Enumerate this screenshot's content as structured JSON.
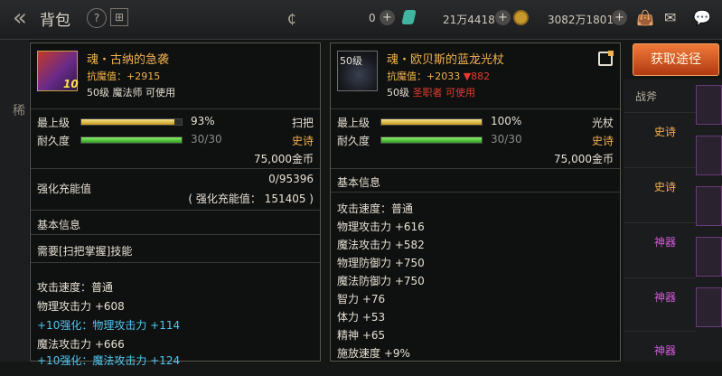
{
  "topbar": {
    "title": "背包",
    "res1": "0",
    "res2": "21万4418",
    "res3": "3082万1801"
  },
  "background": {
    "left_char": "稀",
    "right_header": "战斧",
    "right_rows": [
      "史诗",
      "史诗",
      "神器",
      "神器",
      "神器"
    ],
    "colors": {
      "epic": "#f2b24e",
      "artifact": "#d25ad8"
    }
  },
  "get_button": "获取途径",
  "left_item": {
    "name": "魂・古纳的急袭",
    "magic_resist": "抗魔值：+2915",
    "level_line": "50级 魔法师 可使用",
    "badge": "10",
    "max_level_label": "最上级",
    "max_level_pct": "93%",
    "max_level_fill": 0.93,
    "type": "扫把",
    "durability_label": "耐久度",
    "durability": "30/30",
    "durability_fill": 1,
    "rarity": "史诗",
    "price": "75,000金币",
    "enhance_label": "强化充能值",
    "enhance_value": "0/95396",
    "enhance_sub": "( 强化充能值： 151405 )",
    "basic_title": "基本信息",
    "requirement": "需要[扫把掌握]技能",
    "stats": [
      {
        "text": "攻击速度：普通",
        "cyan": false
      },
      {
        "text": "物理攻击力 +608",
        "cyan": false
      },
      {
        "text": "+10强化：物理攻击力 +114",
        "cyan": true
      },
      {
        "text": "魔法攻击力 +666",
        "cyan": false
      },
      {
        "text": "+10强化：魔法攻击力 +124",
        "cyan": true
      }
    ]
  },
  "right_item": {
    "level_badge": "50级",
    "name": "魂・欧贝斯的蓝龙光杖",
    "magic_resist": "抗魔值：+2033",
    "magic_resist_diff": "▼882",
    "level": "50级",
    "class_req": "圣职者 可使用",
    "max_level_label": "最上级",
    "max_level_pct": "100%",
    "max_level_fill": 1,
    "type": "光杖",
    "durability_label": "耐久度",
    "durability": "30/30",
    "durability_fill": 1,
    "rarity": "史诗",
    "price": "75,000金币",
    "basic_title": "基本信息",
    "stats": [
      "攻击速度：普通",
      "物理攻击力 +616",
      "魔法攻击力 +582",
      "物理防御力 +750",
      "魔法防御力 +750",
      "智力 +76",
      "体力 +53",
      "精神 +65",
      "施放速度 +9%"
    ]
  }
}
